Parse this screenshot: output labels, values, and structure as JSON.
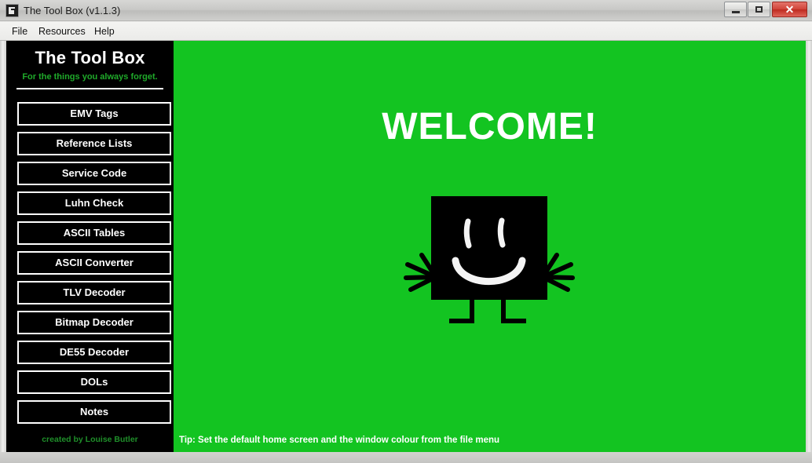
{
  "window": {
    "title": "The Tool Box (v1.1.3)",
    "app_icon": "toolbox-app-icon",
    "controls": {
      "minimize": "minimize-icon",
      "maximize": "maximize-icon",
      "close": "close-icon",
      "close_glyph": "✕"
    }
  },
  "menubar": {
    "items": [
      {
        "label": "File",
        "name": "menu-file"
      },
      {
        "label": "Resources",
        "name": "menu-resources"
      },
      {
        "label": "Help",
        "name": "menu-help"
      }
    ]
  },
  "sidebar": {
    "brand_title": "The Tool Box",
    "brand_tagline": "For the things you always forget.",
    "credit": "created by Louise Butler",
    "buttons": [
      {
        "label": "EMV Tags",
        "name": "nav-emv-tags"
      },
      {
        "label": "Reference Lists",
        "name": "nav-reference-lists"
      },
      {
        "label": "Service Code",
        "name": "nav-service-code"
      },
      {
        "label": "Luhn Check",
        "name": "nav-luhn-check"
      },
      {
        "label": "ASCII Tables",
        "name": "nav-ascii-tables"
      },
      {
        "label": "ASCII Converter",
        "name": "nav-ascii-converter"
      },
      {
        "label": "TLV Decoder",
        "name": "nav-tlv-decoder"
      },
      {
        "label": "Bitmap Decoder",
        "name": "nav-bitmap-decoder"
      },
      {
        "label": "DE55 Decoder",
        "name": "nav-de55-decoder"
      },
      {
        "label": "DOLs",
        "name": "nav-dols"
      },
      {
        "label": "Notes",
        "name": "nav-notes"
      }
    ]
  },
  "main": {
    "welcome_heading": "WELCOME!",
    "mascot": "smiling-toolbox-mascot",
    "tip": "Tip: Set the default home screen and the window colour from the file menu"
  },
  "colors": {
    "window_background": "#13c421",
    "sidebar_background": "#000000",
    "accent_green": "#1faa2a",
    "text_white": "#ffffff",
    "close_button_red": "#cc3328"
  }
}
